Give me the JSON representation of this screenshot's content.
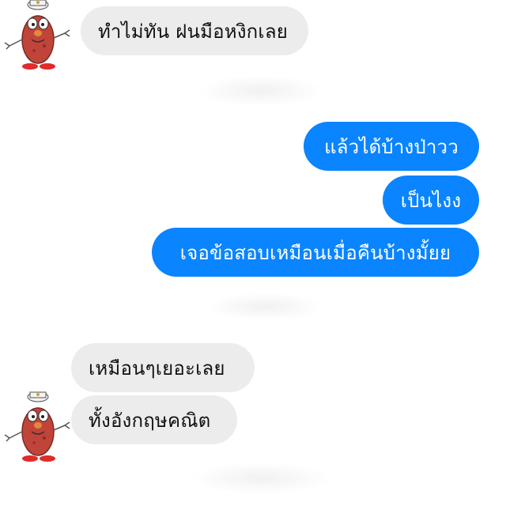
{
  "colors": {
    "incoming_bubble": "#ececec",
    "outgoing_bubble": "#0a84ff",
    "background": "#ffffff"
  },
  "avatar": {
    "icon": "potato-character-avatar-icon"
  },
  "messages": [
    {
      "direction": "incoming",
      "text": "ทำไม่ทัน ฝนมือหงิกเลย"
    },
    {
      "direction": "outgoing",
      "text": "แล้วได้บ้างป่าวว"
    },
    {
      "direction": "outgoing",
      "text": "เป็นไงง"
    },
    {
      "direction": "outgoing",
      "text": "เจอข้อสอบเหมือนเมื่อคืนบ้างมั้ยย"
    },
    {
      "direction": "incoming",
      "text": "เหมือนๆเยอะเลย"
    },
    {
      "direction": "incoming",
      "text": "ทั้งอังกฤษคณิต"
    }
  ]
}
